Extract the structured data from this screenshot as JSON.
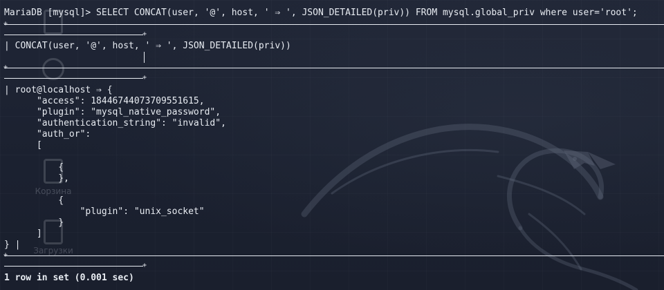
{
  "background": {
    "color": "#1d2230",
    "dragon_icon": "kali-dragon-icon",
    "desktop_icons": [
      {
        "label": "",
        "icon": "home-icon"
      },
      {
        "label": "",
        "icon": "disk-icon"
      },
      {
        "label": "Корзина",
        "icon": "trash-icon"
      },
      {
        "label": "",
        "icon": "usb-icon"
      },
      {
        "label": "Загрузки",
        "icon": "folder-icon"
      }
    ]
  },
  "terminal": {
    "text_color": "#e8ecf2",
    "prompt": "MariaDB [mysql]>",
    "query": " SELECT CONCAT(user, '@', host, ' ⇒ ', JSON_DETAILED(priv)) FROM mysql.global_priv where user='root';",
    "column_header": "CONCAT(user, '@', host, ' ⇒ ', JSON_DETAILED(priv))",
    "result_lines": [
      "root@localhost ⇒ {",
      "    \"access\": 18446744073709551615,",
      "    \"plugin\": \"mysql_native_password\",",
      "    \"authentication_string\": \"invalid\",",
      "    \"auth_or\":",
      "    [",
      "",
      "        {",
      "        },",
      "",
      "        {",
      "            \"plugin\": \"unix_socket\"",
      "        }",
      "    ]",
      "}"
    ],
    "footer": "1 row in set (0.001 sec)"
  }
}
